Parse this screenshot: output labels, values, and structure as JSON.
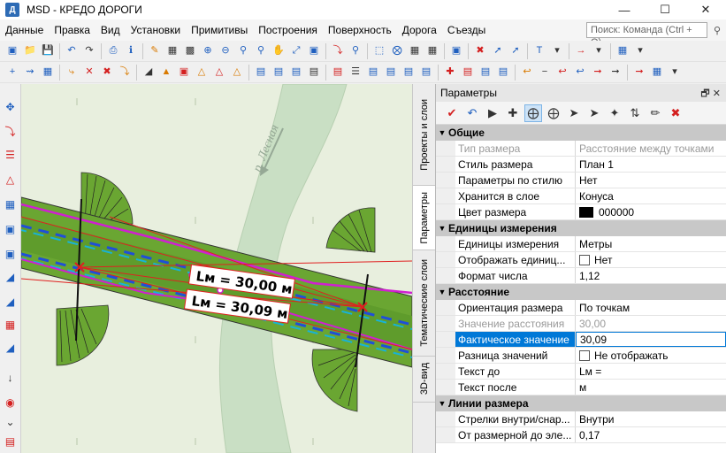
{
  "window": {
    "title": "MSD - КРЕДО ДОРОГИ",
    "app_icon": "Д",
    "minimize": "—",
    "maximize": "☐",
    "close": "✕"
  },
  "menu": {
    "items": [
      "Данные",
      "Правка",
      "Вид",
      "Установки",
      "Примитивы",
      "Построения",
      "Поверхность",
      "Дорога",
      "Съезды"
    ],
    "search_placeholder": "Поиск: Команда (Ctrl + Q)"
  },
  "canvas": {
    "river_label": "р. Лесная",
    "dim1_text": "Lм = 30,00 м",
    "dim2_text": "Lм = 30,09 м"
  },
  "vertical_tabs": [
    "Проекты и слои",
    "Параметры",
    "Тематические слои",
    "3D-вид"
  ],
  "panel": {
    "title": "Параметры",
    "head_buttons": "🗗  ✕",
    "categories": {
      "general": "Общие",
      "units": "Единицы измерения",
      "distance": "Расстояние",
      "lines": "Линии размера"
    },
    "rows": {
      "type": {
        "name": "Тип размера",
        "value": "Расстояние между точками"
      },
      "style": {
        "name": "Стиль размера",
        "value": "План 1"
      },
      "by_style": {
        "name": "Параметры по стилю",
        "value": "Нет"
      },
      "layer": {
        "name": "Хранится в слое",
        "value": "Конуса"
      },
      "color": {
        "name": "Цвет размера",
        "value": "000000"
      },
      "units": {
        "name": "Единицы измерения",
        "value": "Метры"
      },
      "show_units": {
        "name": "Отображать единиц...",
        "value": "Нет"
      },
      "format": {
        "name": "Формат числа",
        "value": "1,12"
      },
      "orientation": {
        "name": "Ориентация размера",
        "value": "По точкам"
      },
      "distance_value": {
        "name": "Значение расстояния",
        "value": "30,00"
      },
      "actual_value": {
        "name": "Фактическое значение",
        "value": "30,09"
      },
      "difference": {
        "name": "Разница значений",
        "value": "Не отображать"
      },
      "text_before": {
        "name": "Текст до",
        "value": "Lм ="
      },
      "text_after": {
        "name": "Текст после",
        "value": "м"
      },
      "arrows": {
        "name": "Стрелки внутри/снар...",
        "value": "Внутри"
      },
      "offset": {
        "name": "От размерной до эле...",
        "value": "0,17"
      }
    }
  },
  "colors": {
    "accent": "#0078d7",
    "road": "#6aa632",
    "dim_red": "#e02020",
    "magenta": "#d020d0",
    "blue_dash": "#1f4fd8",
    "cyan_dash": "#17b3d8"
  }
}
